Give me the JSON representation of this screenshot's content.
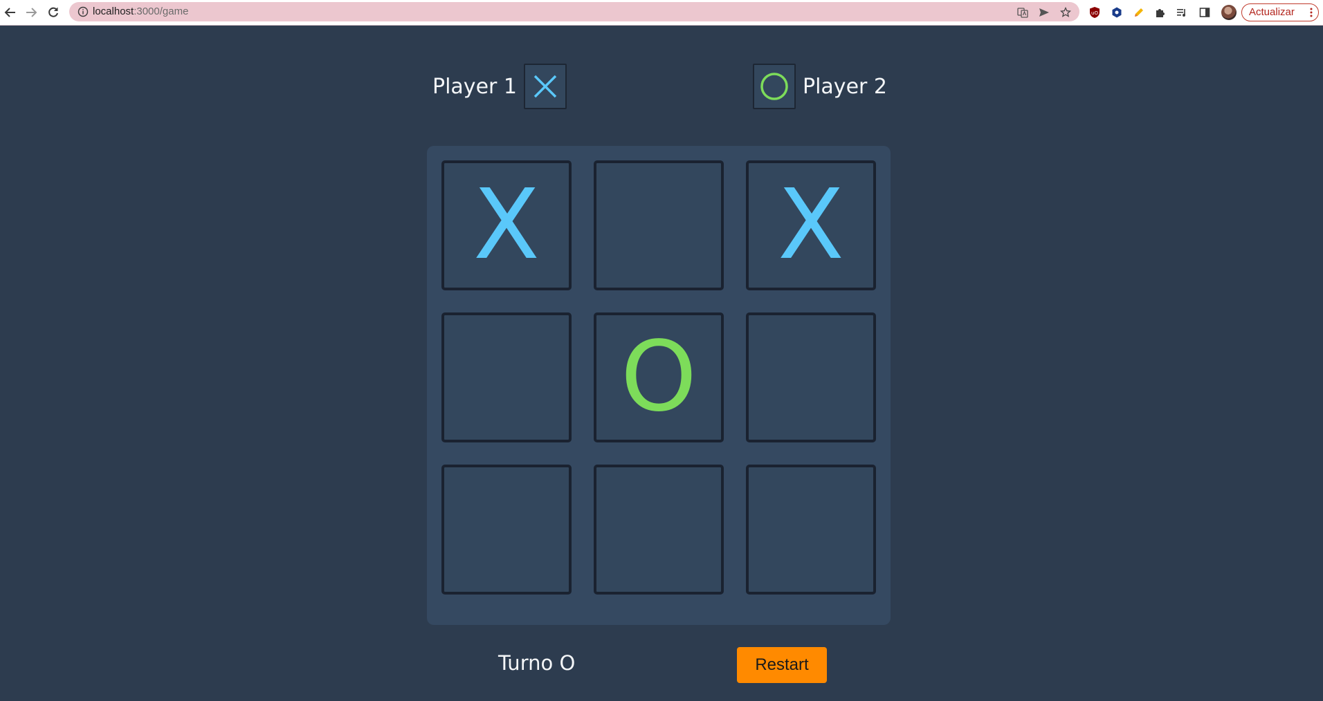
{
  "browser": {
    "url_host": "localhost",
    "url_path": ":3000/game",
    "update_button_label": "Actualizar",
    "icons": {
      "back": "back-arrow-icon",
      "forward": "forward-arrow-icon",
      "reload": "reload-icon",
      "site_info": "info-icon",
      "translate": "translate-icon",
      "send": "send-icon",
      "bookmark": "star-icon",
      "extensions": [
        "ublock-icon",
        "extension-hexagon-icon",
        "pencil-icon",
        "puzzle-icon",
        "media-queue-icon",
        "side-panel-icon"
      ],
      "menu": "kebab-menu-icon"
    }
  },
  "game": {
    "player1": {
      "name": "Player 1",
      "symbol": "X"
    },
    "player2": {
      "name": "Player 2",
      "symbol": "O"
    },
    "board": [
      [
        "X",
        "",
        "X"
      ],
      [
        "",
        "O",
        ""
      ],
      [
        "",
        "",
        ""
      ]
    ],
    "turn_text": "Turno O",
    "restart_label": "Restart"
  },
  "colors": {
    "background": "#2d3c4f",
    "board": "#354961",
    "cell": "#33475d",
    "cell_border": "#1a2230",
    "x_color": "#5ac8fa",
    "o_color": "#7ddc5a",
    "restart_button": "#ff8a00",
    "text": "#f4f6f8"
  }
}
